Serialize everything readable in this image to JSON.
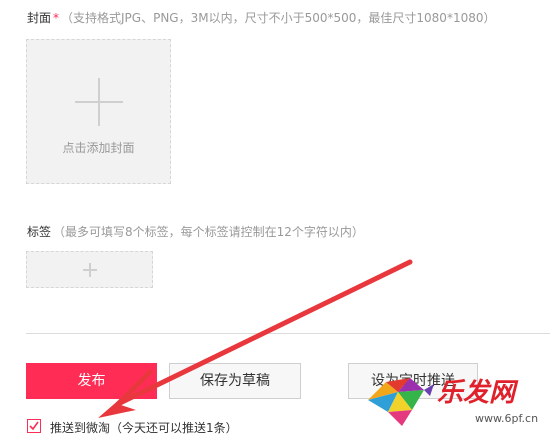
{
  "cover": {
    "label": "封面",
    "required_mark": "*",
    "hint": "（支持格式JPG、PNG，3M以内，尺寸不小于500*500，最佳尺寸1080*1080）",
    "upload_caption": "点击添加封面"
  },
  "tags": {
    "label": "标签",
    "hint": "（最多可填写8个标签，每个标签请控制在12个字符以内）"
  },
  "actions": {
    "publish_label": "发布",
    "draft_label": "保存为草稿",
    "timer_label": "设为定时推送"
  },
  "push": {
    "checked": true,
    "label": "推送到微淘（今天还可以推送1条）"
  },
  "watermark": {
    "brand": "乐发网",
    "site": "www.6pf.cn"
  },
  "colors": {
    "accent": "#ff2d55",
    "arrow": "#e8383d"
  }
}
